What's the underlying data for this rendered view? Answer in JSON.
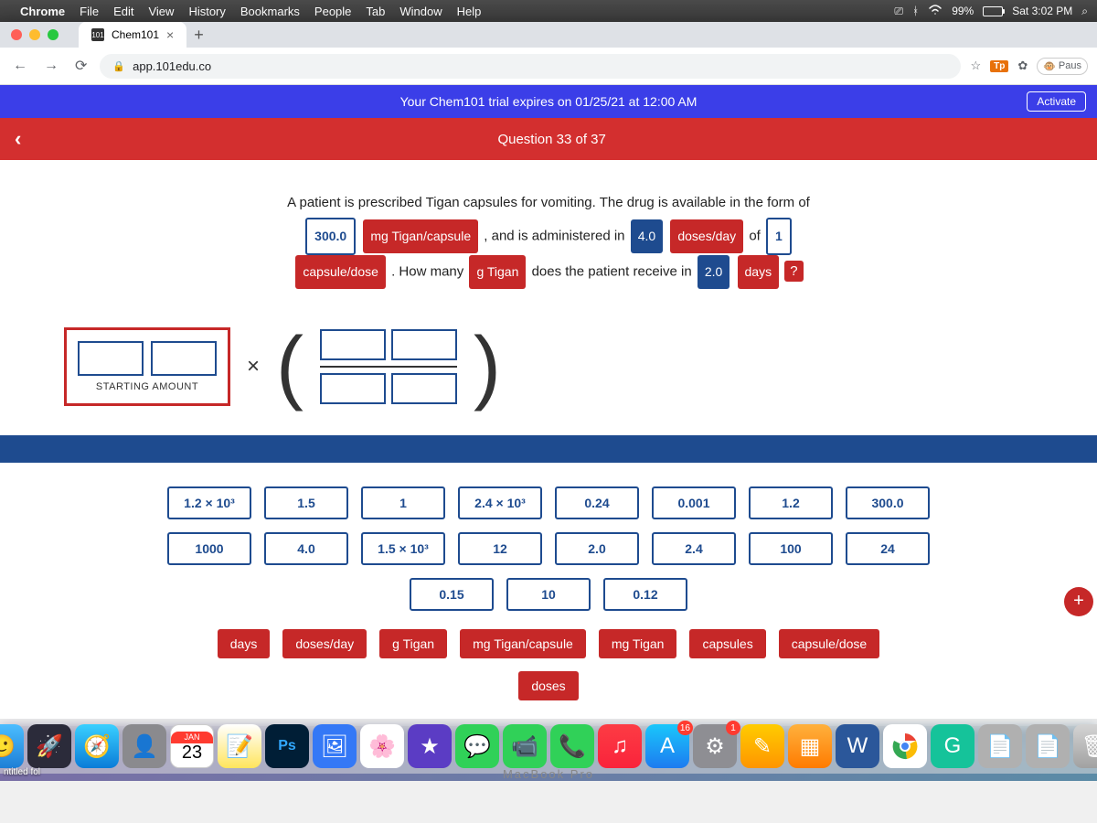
{
  "menubar": {
    "app": "Chrome",
    "items": [
      "File",
      "Edit",
      "View",
      "History",
      "Bookmarks",
      "People",
      "Tab",
      "Window",
      "Help"
    ],
    "battery_pct": "99%",
    "clock": "Sat 3:02 PM"
  },
  "browser": {
    "tab_favicon": "101",
    "tab_title": "Chem101",
    "url": "app.101edu.co",
    "ext_tp": "Tp",
    "ext_paus": "Paus"
  },
  "trial": {
    "text": "Your Chem101 trial expires on 01/25/21 at 12:00 AM",
    "activate": "Activate"
  },
  "question_header": "Question 33 of 37",
  "problem": {
    "intro": "A patient is prescribed Tigan capsules for vomiting. The drug is available in the form of",
    "v1": "300.0",
    "u1": "mg Tigan/capsule",
    "t2": ", and is administered in",
    "v2": "4.0",
    "u2": "doses/day",
    "t3": "of",
    "v3": "1",
    "u3": "capsule/dose",
    "t4": ". How many",
    "u4": "g Tigan",
    "t5": "does the patient receive in",
    "v4": "2.0",
    "u5": "days",
    "qm": "?"
  },
  "starting_label": "STARTING AMOUNT",
  "num_tiles": [
    "1.2 × 10³",
    "1.5",
    "1",
    "2.4 × 10³",
    "0.24",
    "0.001",
    "1.2",
    "300.0",
    "1000",
    "4.0",
    "1.5 × 10³",
    "12",
    "2.0",
    "2.4",
    "100",
    "24",
    "0.15",
    "10",
    "0.12"
  ],
  "unit_tiles": [
    "days",
    "doses/day",
    "g Tigan",
    "mg Tigan/capsule",
    "mg Tigan",
    "capsules",
    "capsule/dose",
    "doses"
  ],
  "dock": {
    "cal_month": "JAN",
    "cal_day": "23",
    "appstore_badge": "16",
    "settings_badge": "1"
  },
  "desktop_item": "ntitled fol",
  "hardware": "MacBook Pro"
}
